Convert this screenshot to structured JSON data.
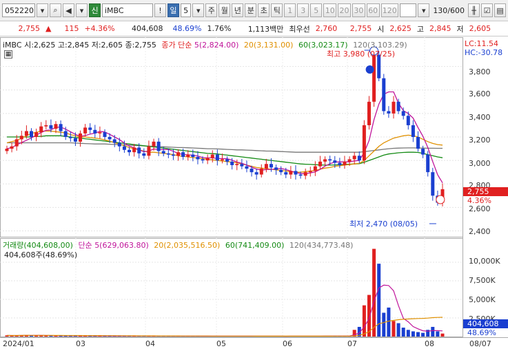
{
  "toolbar": {
    "code": "052220",
    "credit_label": "신",
    "stock_name": "iMBC",
    "alert_label": "!",
    "periods": [
      "일",
      "주",
      "월",
      "년",
      "분",
      "초",
      "틱"
    ],
    "selected_period_value": "5",
    "intervals": [
      "1",
      "3",
      "5",
      "10",
      "20",
      "30",
      "60",
      "120"
    ],
    "count": "130",
    "total": "/600"
  },
  "quote": {
    "price": "2,755",
    "change_arrow": "▲",
    "change": "115",
    "change_pct": "+4.36%",
    "volume": "404,608",
    "volume_ratio": "48.69%",
    "turnover": "1.76%",
    "amount": "1,113백만",
    "bid_label": "최우선",
    "bid": "2,760",
    "ask": "2,755",
    "open_label": "시",
    "open": "2,625",
    "high_label": "고",
    "high": "2,845",
    "low_label": "저",
    "low": "2,605"
  },
  "price_panel": {
    "title": "iMBC 시:2,625 고:2,845 저:2,605 종:2,755",
    "ma_title": "종가 단순",
    "ma5": "5(2,824.00)",
    "ma20": "20(3,131.00)",
    "ma60": "60(3,023.17)",
    "ma120": "120(3,103.29)",
    "high_note": "최고 3,980 (07/25)",
    "low_note": "최저 2,470 (08/05)",
    "lc": "LC:11.54",
    "hc": "HC:-30.78",
    "current": "2,755",
    "current_pct": "4.36%",
    "y_ticks": [
      "3,800",
      "3,600",
      "3,400",
      "3,200",
      "3,000",
      "2,800",
      "2,600",
      "2,400"
    ]
  },
  "volume_panel": {
    "title": "거래량(404,608,00)",
    "ma_title": "단순",
    "ma5": "5(629,063.80)",
    "ma20": "20(2,035,516.50)",
    "ma60": "60(741,409.00)",
    "ma120": "120(434,773.48)",
    "sub": "404,608주(48.69%)",
    "y_ticks": [
      "10,000K",
      "7,500K",
      "5,000K",
      "2,500K"
    ],
    "current": "404,608",
    "current_pct": "48.69%"
  },
  "date_axis": [
    "2024/01",
    "03",
    "04",
    "05",
    "06",
    "07",
    "08",
    "08/07"
  ],
  "colors": {
    "up": "#e02020",
    "down": "#1a3fd0",
    "ma5": "#c0149a",
    "ma20": "#e09000",
    "ma60": "#138a13",
    "ma120": "#777777"
  },
  "chart_data": {
    "type": "candlestick",
    "price_series": [
      3100,
      3120,
      3180,
      3210,
      3250,
      3200,
      3240,
      3290,
      3300,
      3270,
      3310,
      3250,
      3200,
      3190,
      3160,
      3230,
      3280,
      3260,
      3230,
      3240,
      3200,
      3180,
      3150,
      3120,
      3090,
      3070,
      3110,
      3060,
      3040,
      3120,
      3160,
      3080,
      3060,
      3050,
      3040,
      3070,
      3030,
      3050,
      3030,
      3010,
      3000,
      3020,
      3050,
      3000,
      3010,
      2990,
      2960,
      2970,
      2950,
      2930,
      2900,
      2880,
      2930,
      2970,
      2940,
      2920,
      2900,
      2880,
      2910,
      2880,
      2870,
      2900,
      2910,
      2950,
      2990,
      3010,
      3000,
      2980,
      2960,
      2990,
      3010,
      3040,
      3000,
      3300,
      3500,
      3900,
      3700,
      3420,
      3400,
      3500,
      3420,
      3380,
      3300,
      3200,
      3100,
      3050,
      2900,
      2700,
      2640,
      2755
    ],
    "volume_series_k": [
      160,
      120,
      140,
      180,
      220,
      150,
      130,
      160,
      140,
      110,
      130,
      120,
      100,
      110,
      90,
      120,
      100,
      90,
      80,
      100,
      90,
      85,
      80,
      90,
      80,
      70,
      80,
      75,
      70,
      90,
      80,
      70,
      60,
      70,
      65,
      60,
      55,
      60,
      70,
      60,
      55,
      60,
      50,
      70,
      55,
      50,
      60,
      55,
      50,
      60,
      70,
      60,
      55,
      50,
      55,
      50,
      45,
      50,
      55,
      60,
      50,
      55,
      60,
      70,
      80,
      90,
      80,
      70,
      60,
      70,
      80,
      900,
      1300,
      4200,
      5600,
      11800,
      9800,
      3200,
      3900,
      2100,
      1800,
      1200,
      900,
      700,
      600,
      500,
      900,
      1300,
      700,
      404
    ],
    "ma20_series": [
      3150,
      3160,
      3170,
      3190,
      3210,
      3230,
      3240,
      3250,
      3250,
      3250,
      3245,
      3240,
      3235,
      3220,
      3210,
      3200,
      3200,
      3195,
      3190,
      3185,
      3175,
      3165,
      3150,
      3140,
      3125,
      3110,
      3100,
      3090,
      3080,
      3070,
      3070,
      3065,
      3060,
      3055,
      3050,
      3040,
      3035,
      3030,
      3025,
      3020,
      3015,
      3010,
      3005,
      3000,
      2995,
      2990,
      2985,
      2980,
      2970,
      2960,
      2950,
      2940,
      2935,
      2930,
      2925,
      2920,
      2915,
      2910,
      2905,
      2900,
      2900,
      2905,
      2910,
      2915,
      2925,
      2935,
      2940,
      2950,
      2955,
      2960,
      2965,
      2970,
      2975,
      3000,
      3040,
      3080,
      3120,
      3150,
      3170,
      3190,
      3200,
      3210,
      3215,
      3210,
      3200,
      3180,
      3160,
      3145,
      3135,
      3131
    ],
    "ma60_series": [
      3200,
      3200,
      3200,
      3200,
      3200,
      3200,
      3205,
      3205,
      3210,
      3210,
      3210,
      3210,
      3205,
      3200,
      3195,
      3190,
      3185,
      3180,
      3175,
      3170,
      3165,
      3160,
      3155,
      3150,
      3145,
      3140,
      3135,
      3130,
      3125,
      3120,
      3115,
      3110,
      3105,
      3100,
      3095,
      3090,
      3085,
      3080,
      3075,
      3070,
      3065,
      3060,
      3058,
      3055,
      3050,
      3045,
      3040,
      3035,
      3030,
      3025,
      3020,
      3015,
      3010,
      3005,
      3000,
      2995,
      2990,
      2985,
      2980,
      2975,
      2970,
      2968,
      2966,
      2964,
      2962,
      2960,
      2960,
      2962,
      2964,
      2966,
      2968,
      2970,
      2972,
      2985,
      3000,
      3015,
      3030,
      3045,
      3055,
      3060,
      3065,
      3068,
      3070,
      3070,
      3068,
      3060,
      3050,
      3040,
      3030,
      3023
    ],
    "ma120_series": [
      3150,
      3150,
      3150,
      3150,
      3150,
      3150,
      3150,
      3150,
      3150,
      3150,
      3150,
      3150,
      3150,
      3150,
      3148,
      3146,
      3144,
      3142,
      3140,
      3140,
      3140,
      3138,
      3136,
      3134,
      3132,
      3130,
      3128,
      3126,
      3124,
      3122,
      3120,
      3118,
      3116,
      3114,
      3112,
      3110,
      3110,
      3108,
      3106,
      3104,
      3102,
      3100,
      3100,
      3098,
      3096,
      3094,
      3092,
      3090,
      3090,
      3088,
      3086,
      3084,
      3082,
      3080,
      3080,
      3078,
      3076,
      3074,
      3072,
      3070,
      3070,
      3070,
      3070,
      3070,
      3070,
      3070,
      3070,
      3070,
      3070,
      3070,
      3070,
      3070,
      3070,
      3075,
      3080,
      3085,
      3090,
      3095,
      3100,
      3103,
      3105,
      3106,
      3107,
      3107,
      3106,
      3105,
      3104,
      3104,
      3103,
      3103
    ],
    "y_range": [
      2350,
      4050
    ],
    "vol_range_k": [
      0,
      12500
    ]
  }
}
